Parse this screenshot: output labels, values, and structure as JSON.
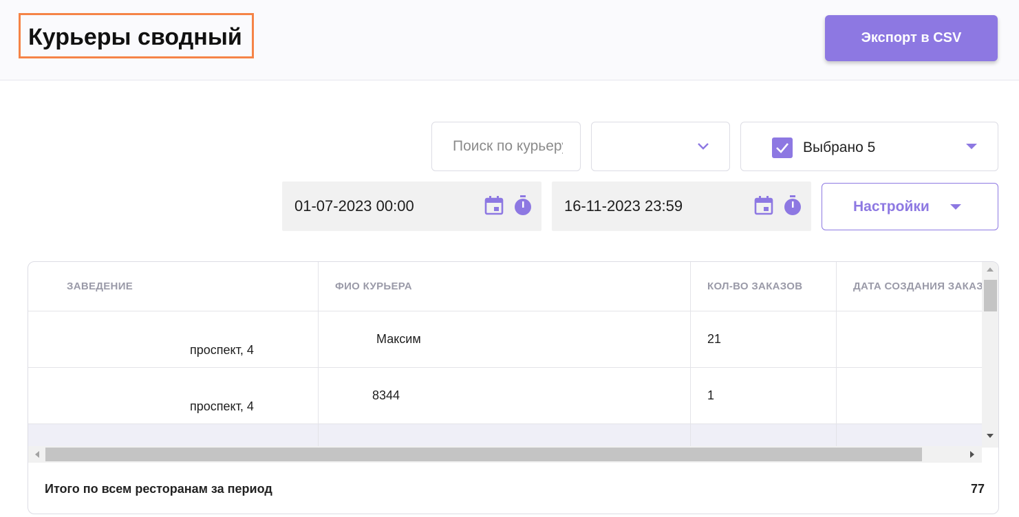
{
  "header": {
    "title": "Курьеры сводный",
    "export_label": "Экспорт в CSV"
  },
  "filters": {
    "search_placeholder": "Поиск по курьеру",
    "select_value": "",
    "multi_label": "Выбрано 5",
    "date_from": "01-07-2023 00:00",
    "date_to": "16-11-2023 23:59",
    "settings_label": "Настройки",
    "accent_color": "#8d78e2"
  },
  "table": {
    "columns": [
      "ЗАВЕДЕНИЕ",
      "ФИО КУРЬЕРА",
      "КОЛ-ВО ЗАКАЗОВ",
      "ДАТА СОЗДАНИЯ ЗАКАЗА"
    ],
    "rows": [
      {
        "venue": "проспект, 4",
        "courier": "Максим",
        "orders": "21",
        "date": ""
      },
      {
        "venue": "проспект, 4",
        "courier": "8344",
        "orders": "1",
        "date": ""
      }
    ]
  },
  "footer": {
    "label": "Итого по всем ресторанам за период",
    "value": "77"
  }
}
